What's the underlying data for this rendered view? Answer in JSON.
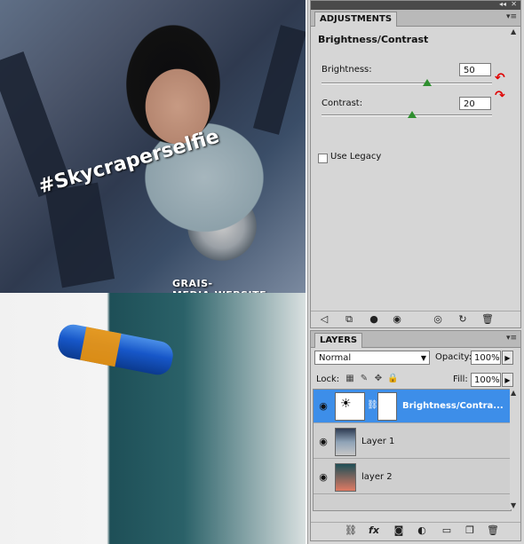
{
  "canvas": {
    "watermark_top": "#Skycraperselfie",
    "watermark_bottom": "GRAIS-MEDIA.WEBSITE"
  },
  "adjustments": {
    "tab_label": "ADJUSTMENTS",
    "title": "Brightness/Contrast",
    "brightness_label": "Brightness:",
    "brightness_value": "50",
    "contrast_label": "Contrast:",
    "contrast_value": "20",
    "use_legacy_label": "Use Legacy",
    "use_legacy_checked": false,
    "brightness_level": 0.62,
    "contrast_level": 0.53,
    "footer_icons": [
      "back-arrow-icon",
      "clip-layer-icon",
      "visibility-circle-icon",
      "eye-icon",
      "view-previous-icon",
      "reset-icon",
      "trash-icon"
    ]
  },
  "layers": {
    "tab_label": "LAYERS",
    "blend_mode": "Normal",
    "opacity_label": "Opacity:",
    "opacity_value": "100%",
    "lock_label": "Lock:",
    "fill_label": "Fill:",
    "fill_value": "100%",
    "rows": [
      {
        "name": "Brightness/Contra...",
        "selected": true
      },
      {
        "name": "Layer 1",
        "selected": false
      },
      {
        "name": "layer 2",
        "selected": false
      }
    ],
    "footer_icons": [
      "link-icon",
      "fx-icon",
      "mask-icon",
      "adjustment-icon",
      "group-folder-icon",
      "new-layer-icon",
      "trash-icon"
    ]
  },
  "colors": {
    "selection": "#3d8ee9",
    "annotation_arrow": "#e00000",
    "slider_thumb": "#2f8f2f"
  }
}
